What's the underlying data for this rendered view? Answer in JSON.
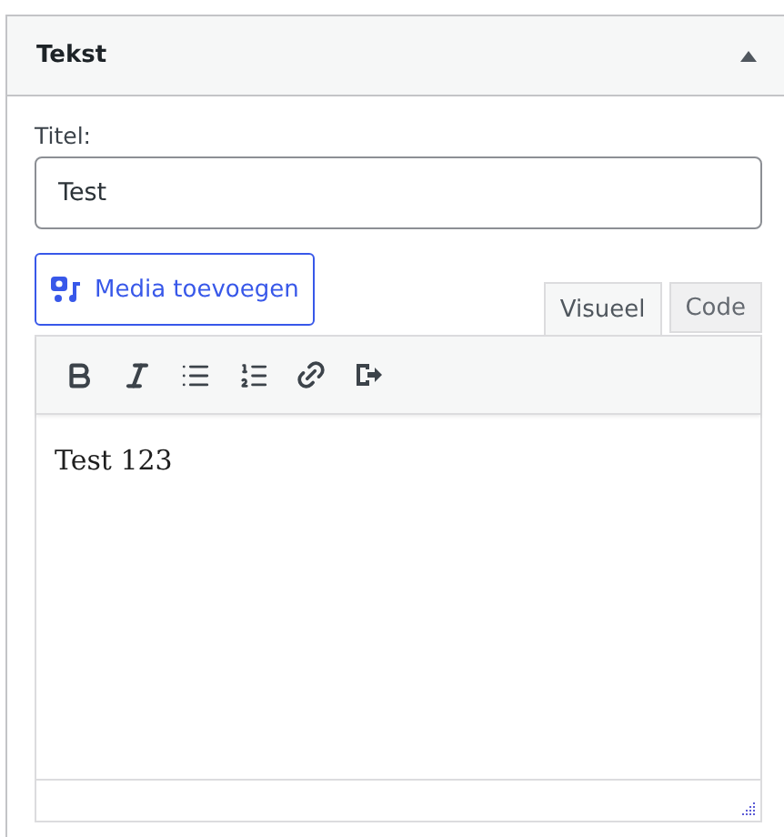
{
  "panel": {
    "title": "Tekst",
    "expanded": true
  },
  "title_field": {
    "label": "Titel:",
    "value": "Test"
  },
  "media_button": "Media toevoegen",
  "tabs": [
    {
      "label": "Visueel",
      "selected": true
    },
    {
      "label": "Code",
      "selected": false
    }
  ],
  "toolbar": [
    {
      "kind": "bold"
    },
    {
      "kind": "italic"
    },
    {
      "kind": "bullets"
    },
    {
      "kind": "numbers"
    },
    {
      "kind": "link"
    },
    {
      "kind": "exit"
    }
  ],
  "content": "Test 123"
}
